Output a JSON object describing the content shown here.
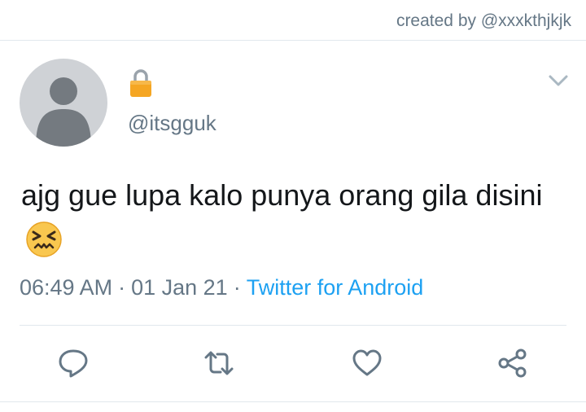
{
  "credit": "created by @xxxkthjkjk",
  "tweet": {
    "handle": "@itsgguk",
    "text": "ajg gue lupa kalo punya orang gila disini",
    "emoji": "confounded-face-emoji",
    "time": "06:49 AM",
    "date": "01 Jan 21",
    "separator": "·",
    "source": "Twitter for Android",
    "protected_icon": "lock-icon"
  },
  "actions": [
    {
      "icon": "reply-icon"
    },
    {
      "icon": "retweet-icon"
    },
    {
      "icon": "like-icon"
    },
    {
      "icon": "share-icon"
    }
  ],
  "colors": {
    "text": "#14171a",
    "secondary": "#657786",
    "accent": "#1da1f2",
    "divider": "#e1e8ed",
    "lock": "#f5a623"
  }
}
